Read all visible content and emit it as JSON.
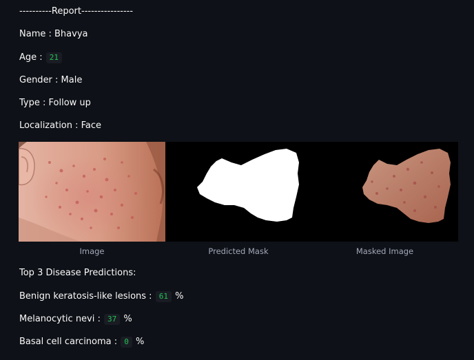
{
  "report": {
    "header": "----------Report----------------",
    "name": "Name : Bhavya",
    "age_label": "Age :",
    "age_value": "21",
    "gender": "Gender : Male",
    "type": "Type : Follow up",
    "localization": "Localization : Face"
  },
  "images": {
    "captions": [
      "Image",
      "Predicted Mask",
      "Masked Image"
    ]
  },
  "predictions": {
    "heading": "Top 3 Disease Predictions:",
    "items": [
      {
        "label": "Benign keratosis-like lesions :",
        "value": "61",
        "unit": "%"
      },
      {
        "label": "Melanocytic nevi :",
        "value": "37",
        "unit": "%"
      },
      {
        "label": "Basal cell carcinoma :",
        "value": "0",
        "unit": "%"
      }
    ]
  },
  "colors": {
    "background": "#0e1117",
    "text": "#fafafa",
    "code_text": "#21c354",
    "code_bg": "#1a1c24",
    "caption": "#a3a8b8"
  }
}
